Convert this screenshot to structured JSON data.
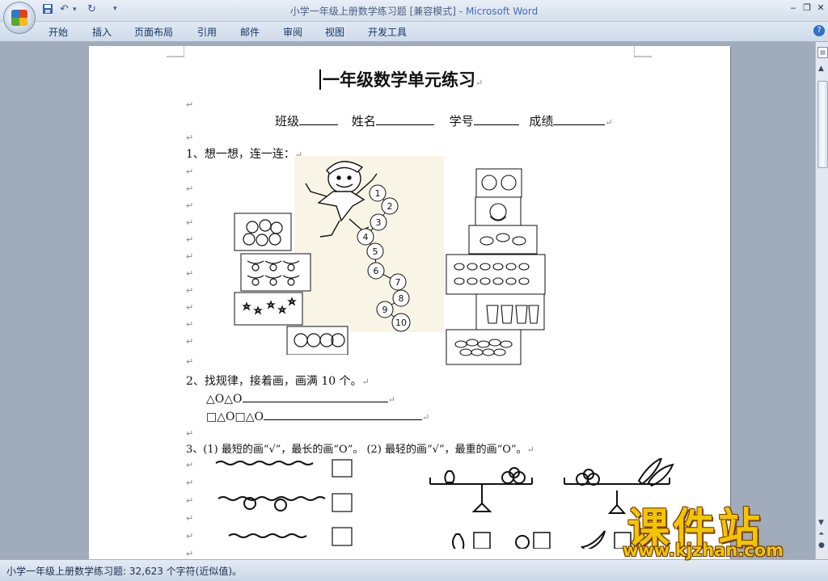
{
  "window": {
    "title": "小学一年级上册数学练习题 [兼容模式]",
    "separator": " - ",
    "app_name": "Microsoft Word",
    "minimize": "‒",
    "restore": "❐",
    "close": "✕"
  },
  "quick_access": {
    "save_icon": "save-icon",
    "undo_icon": "undo-icon",
    "redo_icon": "redo-icon",
    "customize": "▾"
  },
  "ribbon": {
    "tabs": [
      "开始",
      "插入",
      "页面布局",
      "引用",
      "邮件",
      "审阅",
      "视图",
      "开发工具"
    ],
    "help": "?"
  },
  "document": {
    "title": "一年级数学单元练习",
    "info": {
      "class_label": "班级",
      "name_label": "姓名",
      "id_label": "学号",
      "score_label": "成绩"
    },
    "q1": {
      "text": "1、想一想，连一连："
    },
    "q2": {
      "text": "2、找规律，接着画，画满 10 个。",
      "pattern1": "△O△O",
      "pattern2": "□△O□△O"
    },
    "q3": {
      "text": "3、(1) 最短的画“√”，最长的画“O”。 (2) 最轻的画“√”，最重的画“O”。"
    },
    "paragraph_mark": "↵",
    "kid_numbers": [
      "1",
      "2",
      "3",
      "4",
      "5",
      "6",
      "7",
      "8",
      "9",
      "10"
    ]
  },
  "statusbar": {
    "text": "小学一年级上册数学练习题: 32,623 个字符(近似值)。"
  },
  "watermark": {
    "main": "课件站",
    "url": "www.kjzhan.com"
  }
}
